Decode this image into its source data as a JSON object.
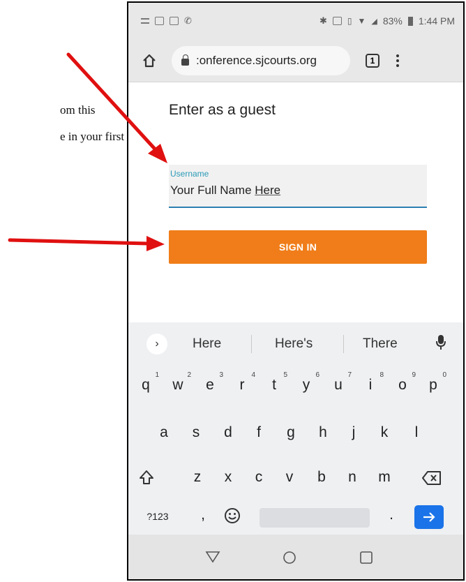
{
  "document": {
    "line1": "om this",
    "line2": "e in your first"
  },
  "status_bar": {
    "battery_text": "83%",
    "time": "1:44 PM"
  },
  "browser": {
    "url": ":onference.sjcourts.org",
    "tab_count": "1"
  },
  "page": {
    "title": "Enter as a guest",
    "username_label": "Username",
    "username_value_prefix": "Your Full Name ",
    "username_value_underlined": "Here",
    "signin_label": "SIGN IN"
  },
  "keyboard": {
    "suggestions": [
      "Here",
      "Here's",
      "There"
    ],
    "row1": [
      "q",
      "w",
      "e",
      "r",
      "t",
      "y",
      "u",
      "i",
      "o",
      "p"
    ],
    "row1_hints": [
      "1",
      "2",
      "3",
      "4",
      "5",
      "6",
      "7",
      "8",
      "9",
      "0"
    ],
    "row2": [
      "a",
      "s",
      "d",
      "f",
      "g",
      "h",
      "j",
      "k",
      "l"
    ],
    "row3": [
      "z",
      "x",
      "c",
      "v",
      "b",
      "n",
      "m"
    ],
    "symbols_key": "?123",
    "comma_key": ",",
    "period_key": "."
  },
  "colors": {
    "accent_orange": "#f07d19",
    "field_underline": "#2b7fb0",
    "enter_blue": "#1a73e8",
    "arrow_red": "#e01010"
  }
}
